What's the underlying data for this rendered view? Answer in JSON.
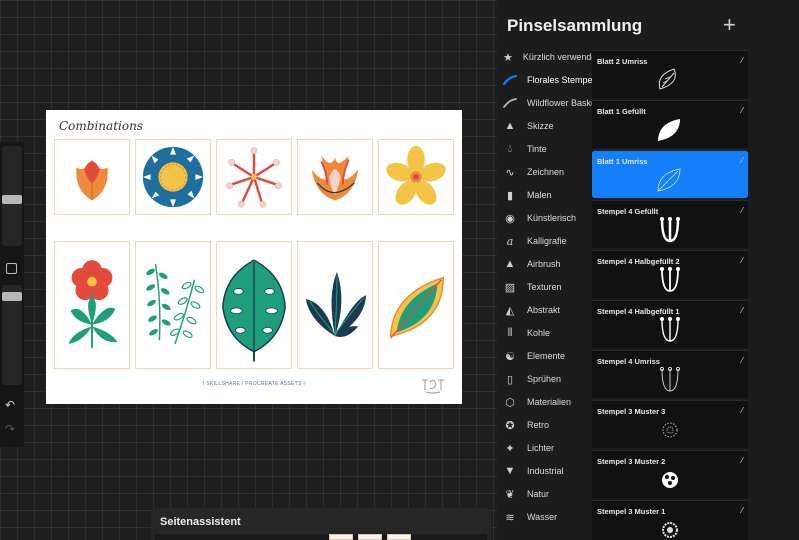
{
  "canvas": {
    "title": "Combinations",
    "footer": "I SKILLSHARE I PROCREATE ASSETS I",
    "tile_colors": {
      "border": "#f2d9b4",
      "teal": "#1f9e7c",
      "navy": "#1a3b52",
      "orange": "#ef8a3c",
      "red": "#e24a3b",
      "yellow": "#f4c447",
      "blue": "#1f6f9e"
    }
  },
  "brush_library": {
    "title": "Pinselsammlung",
    "add_label": "+",
    "categories": [
      {
        "label": "Kürzlich verwendet",
        "icon": "star-icon"
      },
      {
        "label": "Florales Stempelst",
        "icon": "blue-stroke-icon"
      },
      {
        "label": "Wildflower Basket",
        "icon": "stroke-icon"
      },
      {
        "label": "Skizze",
        "icon": "pencil-tip-icon"
      },
      {
        "label": "Tinte",
        "icon": "ink-drop-icon"
      },
      {
        "label": "Zeichnen",
        "icon": "squiggle-icon"
      },
      {
        "label": "Malen",
        "icon": "paint-brush-icon"
      },
      {
        "label": "Künstlerisch",
        "icon": "palette-icon"
      },
      {
        "label": "Kalligrafie",
        "icon": "calligraphy-icon"
      },
      {
        "label": "Airbrush",
        "icon": "airbrush-icon"
      },
      {
        "label": "Texturen",
        "icon": "texture-icon"
      },
      {
        "label": "Abstrakt",
        "icon": "triangle-icon"
      },
      {
        "label": "Kohle",
        "icon": "charcoal-icon"
      },
      {
        "label": "Elemente",
        "icon": "yin-yang-icon"
      },
      {
        "label": "Sprühen",
        "icon": "spray-can-icon"
      },
      {
        "label": "Materialien",
        "icon": "cube-icon"
      },
      {
        "label": "Retro",
        "icon": "retro-badge-icon"
      },
      {
        "label": "Lichter",
        "icon": "sparkle-icon"
      },
      {
        "label": "Industrial",
        "icon": "anvil-icon"
      },
      {
        "label": "Natur",
        "icon": "leaf-icon"
      },
      {
        "label": "Wasser",
        "icon": "waves-icon"
      }
    ],
    "selected_category": "Florales Stempelst",
    "brushes": [
      {
        "name": "Blatt 2 Umriss"
      },
      {
        "name": "Blatt 1 Gefüllt"
      },
      {
        "name": "Blatt 1 Umriss",
        "selected": true
      },
      {
        "name": "Stempel 4 Gefüllt"
      },
      {
        "name": "Stempel 4 Halbgefüllt 2"
      },
      {
        "name": "Stempel 4 Halbgefüllt 1"
      },
      {
        "name": "Stempel 4 Umriss"
      },
      {
        "name": "Stempel 3 Muster 3"
      },
      {
        "name": "Stempel 3 Muster 2"
      },
      {
        "name": "Stempel 3 Muster 1"
      }
    ],
    "accent": "#147efb"
  },
  "page_assist": {
    "title": "Seitenassistent"
  },
  "sidebar": {
    "undo": "↶",
    "redo": "↷"
  }
}
